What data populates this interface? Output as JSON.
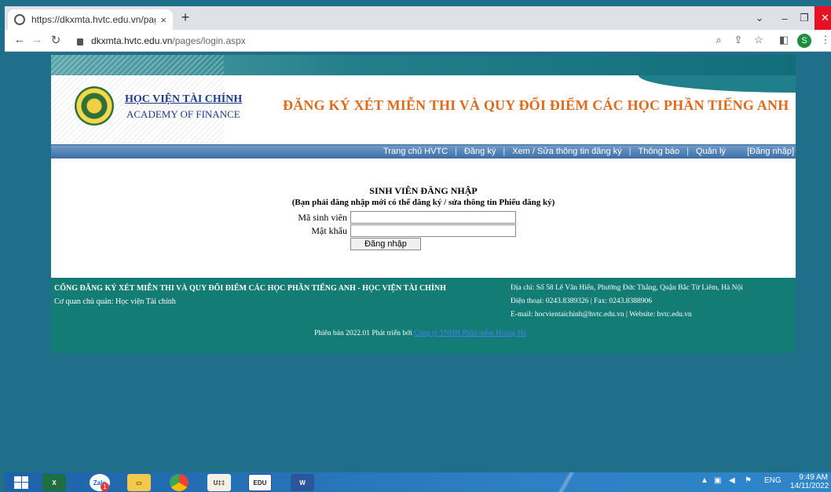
{
  "browser": {
    "tab_title": "https://dkxmta.hvtc.edu.vn/page",
    "tab_close": "×",
    "new_tab": "+",
    "url_host": "dkxmta.hvtc.edu.vn",
    "url_path": "/pages/login.aspx",
    "profile_initial": "S"
  },
  "header": {
    "school_name_vi": "HỌC VIỆN TÀI CHÍNH",
    "school_name_en": "ACADEMY OF FINANCE",
    "title": "ĐĂNG KÝ XÉT MIỄN THI VÀ QUY ĐỔI ĐIỂM CÁC HỌC PHẦN TIẾNG ANH"
  },
  "menu": {
    "items": [
      "Trang chủ HVTC",
      "Đăng ký",
      "Xem / Sửa thông tin đăng ký",
      "Thông báo",
      "Quản lý"
    ],
    "login_link": "[Đăng nhập]"
  },
  "login": {
    "title": "SINH VIÊN ĐĂNG NHẬP",
    "note": "(Bạn phải đăng nhập mới có thể đăng ký / sửa thông tin Phiếu đăng ký)",
    "student_id_label": "Mã sinh viên",
    "student_id_value": "",
    "password_label": "Mật khẩu",
    "password_value": "",
    "submit_label": "Đăng nhập"
  },
  "footer": {
    "title": "CỔNG ĐĂNG KÝ XÉT MIỄN THI VÀ QUY ĐỔI ĐIỂM CÁC HỌC PHẦN TIẾNG ANH - HỌC VIỆN TÀI CHÍNH",
    "owner": "Cơ quan chủ quản: Học viện Tài chính",
    "address": "Địa chỉ: Số 58 Lê Văn Hiến, Phường Đức Thắng, Quận Bắc Từ Liêm, Hà Nội",
    "phone": "Điện thoại: 0243.8389326 | Fax: 0243.8388906",
    "email": "E-mail: hocvientaichinh@hvtc.edu.vn | Website: hvtc.edu.vn",
    "version": "Phiên bản 2022.01 Phát triển bởi",
    "developer": "Công ty TNHH Phần mềm Hoàng Hà"
  },
  "taskbar": {
    "zalo_badge": "1",
    "apps": [
      "excel-icon",
      "zalo-icon",
      "file-explorer-icon",
      "chrome-icon",
      "ut-maker-icon",
      "edu-icon",
      "word-icon"
    ],
    "language": "ENG",
    "time": "9:49 AM",
    "date": "14/11/2022"
  },
  "colors": {
    "desktop": "#1f6f8b",
    "banner_title": "#e06a1b",
    "school_name": "#1e3a8a",
    "menu_bar": "#4f7fb5",
    "footer": "#137c74"
  }
}
